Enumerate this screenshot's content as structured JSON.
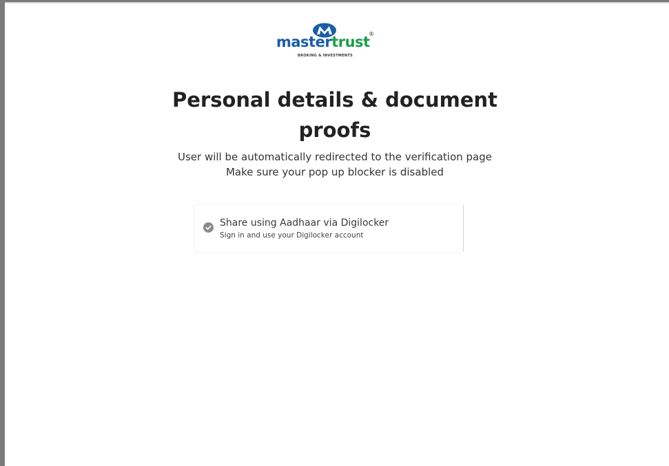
{
  "brand": {
    "name_part1": "master",
    "name_part2": "trust",
    "registered_mark": "®",
    "tagline": "BROKING & INVESTMENTS",
    "colors": {
      "primary_blue": "#1b5da8",
      "primary_green": "#1e9e4a"
    },
    "icon": "mastertrust-m-logo-icon"
  },
  "page": {
    "title": "Personal details & document proofs",
    "subtitle_line1": "User will be automatically redirected to the verification page",
    "subtitle_line2": "Make sure your pop up blocker is disabled"
  },
  "options": [
    {
      "title": "Share using Aadhaar via Digilocker",
      "description": "Sign in and use your Digilocker account",
      "icon": "check-circle-icon",
      "selected": true
    }
  ]
}
